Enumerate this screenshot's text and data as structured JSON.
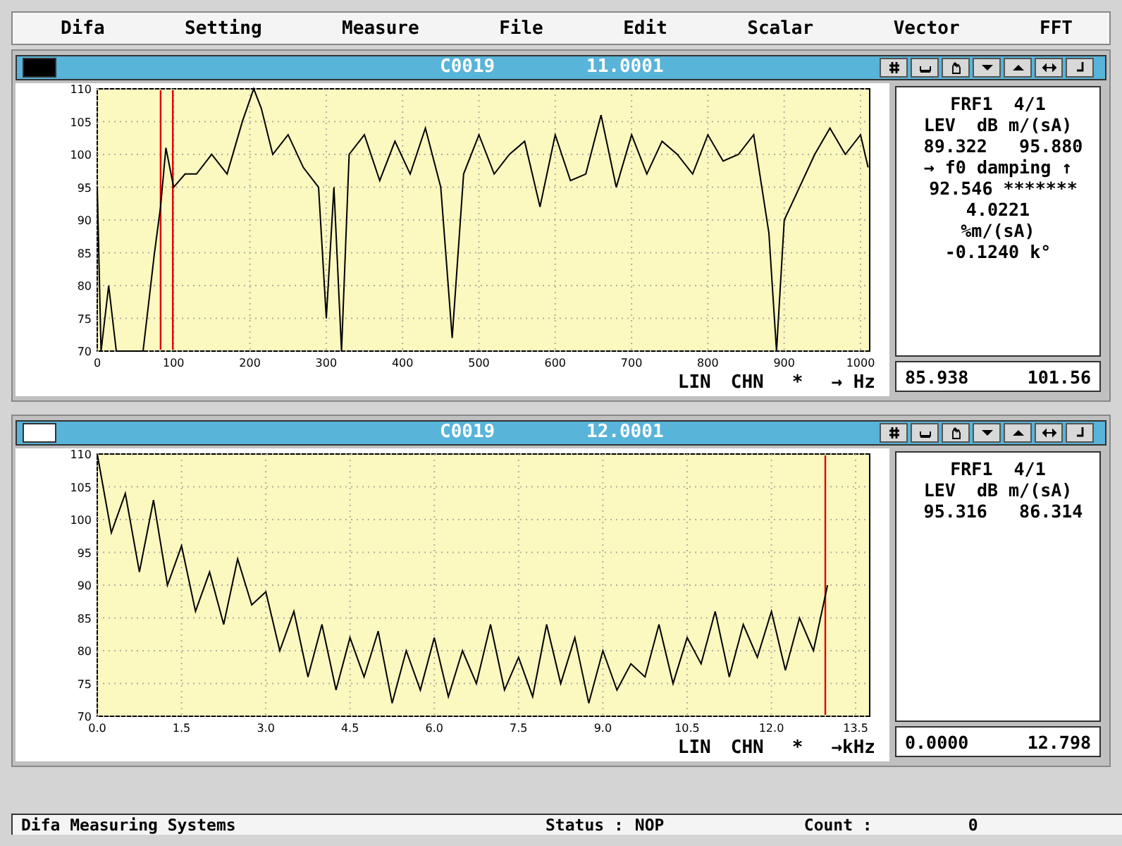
{
  "menu": [
    "Difa",
    "Setting",
    "Measure",
    "File",
    "Edit",
    "Scalar",
    "Vector",
    "FFT"
  ],
  "panels": [
    {
      "active": true,
      "title": "C0019",
      "subtitle": "11.0001",
      "chart_data": {
        "type": "line",
        "xlim": [
          0,
          1012
        ],
        "ylim": [
          70,
          110
        ],
        "xticks": [
          0,
          100,
          200,
          300,
          400,
          500,
          600,
          700,
          800,
          900,
          1000
        ],
        "yticks": [
          70,
          75,
          80,
          85,
          90,
          95,
          100,
          105,
          110
        ],
        "x": [
          0,
          5,
          15,
          25,
          40,
          60,
          75,
          83,
          90,
          100,
          115,
          130,
          150,
          170,
          190,
          205,
          215,
          230,
          250,
          270,
          290,
          300,
          310,
          320,
          330,
          350,
          370,
          390,
          410,
          430,
          450,
          465,
          480,
          500,
          520,
          540,
          560,
          580,
          600,
          620,
          640,
          660,
          680,
          700,
          720,
          740,
          760,
          780,
          800,
          820,
          840,
          860,
          880,
          890,
          900,
          920,
          940,
          960,
          980,
          1000,
          1010
        ],
        "grid": true,
        "series": [
          {
            "color": "#000000",
            "values": [
              95,
              70,
              80,
              70,
              70,
              70,
              85,
              92,
              101,
              95,
              97,
              97,
              100,
              97,
              105,
              110,
              107,
              100,
              103,
              98,
              95,
              75,
              95,
              70,
              100,
              103,
              96,
              102,
              97,
              104,
              95,
              72,
              97,
              103,
              97,
              100,
              102,
              92,
              103,
              96,
              97,
              106,
              95,
              103,
              97,
              102,
              100,
              97,
              103,
              99,
              100,
              103,
              88,
              70,
              90,
              95,
              100,
              104,
              100,
              103,
              98
            ]
          }
        ],
        "ref_lines": [
          {
            "axis": "x",
            "value": 83,
            "color": "#e00000"
          },
          {
            "axis": "x",
            "value": 99,
            "color": "#e00000"
          }
        ]
      },
      "axis_footer": [
        "LIN",
        "CHN",
        "*",
        "→ Hz"
      ],
      "info": [
        "FRF1  4/1",
        "LEV  dB m/(sA)",
        " 89.322   95.880",
        "→ f0 damping ↑",
        " 92.546 *******",
        "4.0221",
        "%m/(sA)",
        "-0.1240 k°"
      ],
      "readout": [
        "85.938",
        "101.56"
      ]
    },
    {
      "active": false,
      "title": "C0019",
      "subtitle": "12.0001",
      "chart_data": {
        "type": "line",
        "xlim": [
          0,
          13.75
        ],
        "ylim": [
          70,
          110
        ],
        "xticks": [
          {
            "value": 0,
            "label": "0.0"
          },
          {
            "value": 1.5,
            "label": "1.5"
          },
          {
            "value": 3,
            "label": "3.0"
          },
          {
            "value": 4.5,
            "label": "4.5"
          },
          {
            "value": 6,
            "label": "6.0"
          },
          {
            "value": 7.5,
            "label": "7.5"
          },
          {
            "value": 9,
            "label": "9.0"
          },
          {
            "value": 10.5,
            "label": "10.5"
          },
          {
            "value": 12,
            "label": "12.0"
          },
          {
            "value": 13.5,
            "label": "13.5"
          }
        ],
        "yticks": [
          70,
          75,
          80,
          85,
          90,
          95,
          100,
          105,
          110
        ],
        "x": [
          0,
          0.25,
          0.5,
          0.75,
          1,
          1.25,
          1.5,
          1.75,
          2,
          2.25,
          2.5,
          2.75,
          3,
          3.25,
          3.5,
          3.75,
          4,
          4.25,
          4.5,
          4.75,
          5,
          5.25,
          5.5,
          5.75,
          6,
          6.25,
          6.5,
          6.75,
          7,
          7.25,
          7.5,
          7.75,
          8,
          8.25,
          8.5,
          8.75,
          9,
          9.25,
          9.5,
          9.75,
          10,
          10.25,
          10.5,
          10.75,
          11,
          11.25,
          11.5,
          11.75,
          12,
          12.25,
          12.5,
          12.75,
          13
        ],
        "grid": true,
        "series": [
          {
            "color": "#000000",
            "values": [
              110,
              98,
              104,
              92,
              103,
              90,
              96,
              86,
              92,
              84,
              94,
              87,
              89,
              80,
              86,
              76,
              84,
              74,
              82,
              76,
              83,
              72,
              80,
              74,
              82,
              73,
              80,
              75,
              84,
              74,
              79,
              73,
              84,
              75,
              82,
              72,
              80,
              74,
              78,
              76,
              84,
              75,
              82,
              78,
              86,
              76,
              84,
              79,
              86,
              77,
              85,
              80,
              90
            ]
          }
        ],
        "ref_lines": [
          {
            "axis": "x",
            "value": 12.96,
            "color": "#e00000"
          }
        ]
      },
      "axis_footer": [
        "LIN",
        "CHN",
        "*",
        "→kHz"
      ],
      "info": [
        "FRF1  4/1",
        "LEV  dB m/(sA)",
        " 95.316   86.314"
      ],
      "readout": [
        "0.0000",
        "12.798"
      ]
    }
  ],
  "status_bar": {
    "app": "Difa Measuring Systems",
    "status_label": "Status :",
    "status": "NOP",
    "count_label": "Count :",
    "count": "0"
  }
}
